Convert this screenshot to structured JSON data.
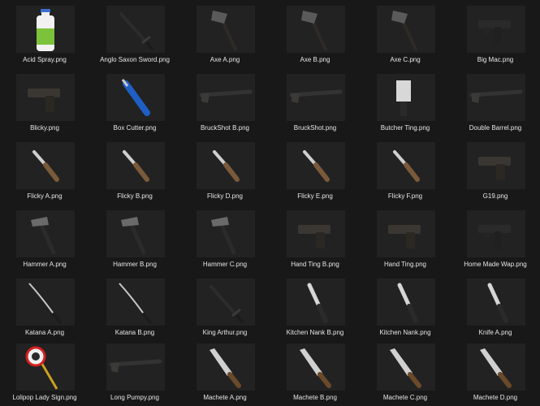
{
  "files": [
    {
      "name": "Acid Spray.png",
      "icon": "bottle-icon"
    },
    {
      "name": "Anglo Saxon Sword.png",
      "icon": "sword-icon"
    },
    {
      "name": "Axe A.png",
      "icon": "axe-icon"
    },
    {
      "name": "Axe B.png",
      "icon": "axe-icon"
    },
    {
      "name": "Axe C.png",
      "icon": "axe-icon"
    },
    {
      "name": "Big Mac.png",
      "icon": "smg-icon"
    },
    {
      "name": "Blicky.png",
      "icon": "pistol-icon"
    },
    {
      "name": "Box Cutter.png",
      "icon": "box-cutter-icon"
    },
    {
      "name": "BruckShot B.png",
      "icon": "shotgun-icon"
    },
    {
      "name": "BruckShot.png",
      "icon": "shotgun-icon"
    },
    {
      "name": "Butcher Ting.png",
      "icon": "cleaver-icon"
    },
    {
      "name": "Double Barrel.png",
      "icon": "shotgun-icon"
    },
    {
      "name": "Flicky A.png",
      "icon": "folding-knife-icon"
    },
    {
      "name": "Flicky B.png",
      "icon": "folding-knife-icon"
    },
    {
      "name": "Flicky D.png",
      "icon": "folding-knife-icon"
    },
    {
      "name": "Flicky E.png",
      "icon": "folding-knife-icon"
    },
    {
      "name": "Flicky F.png",
      "icon": "folding-knife-icon"
    },
    {
      "name": "G19.png",
      "icon": "pistol-icon"
    },
    {
      "name": "Hammer A.png",
      "icon": "hammer-icon"
    },
    {
      "name": "Hammer B.png",
      "icon": "hammer-icon"
    },
    {
      "name": "Hammer C.png",
      "icon": "hammer-icon"
    },
    {
      "name": "Hand Ting B.png",
      "icon": "pistol-icon"
    },
    {
      "name": "Hand Ting.png",
      "icon": "pistol-icon"
    },
    {
      "name": "Home Made Wap.png",
      "icon": "smg-icon"
    },
    {
      "name": "Katana A.png",
      "icon": "katana-icon"
    },
    {
      "name": "Katana B.png",
      "icon": "katana-icon"
    },
    {
      "name": "King Arthur.png",
      "icon": "sword-icon"
    },
    {
      "name": "Kitchen Nank B.png",
      "icon": "knife-icon"
    },
    {
      "name": "Kitchen Nank.png",
      "icon": "knife-icon"
    },
    {
      "name": "Knife A.png",
      "icon": "knife-icon"
    },
    {
      "name": "Lolipop Lady Sign.png",
      "icon": "sign-icon"
    },
    {
      "name": "Long Pumpy.png",
      "icon": "shotgun-icon"
    },
    {
      "name": "Machete A.png",
      "icon": "machete-icon"
    },
    {
      "name": "Machete B.png",
      "icon": "machete-icon"
    },
    {
      "name": "Machete C.png",
      "icon": "machete-icon"
    },
    {
      "name": "Machete D.png",
      "icon": "machete-icon"
    }
  ],
  "colors": {
    "background": "#181818",
    "tile": "#222222",
    "caption": "#e6e6e6"
  }
}
